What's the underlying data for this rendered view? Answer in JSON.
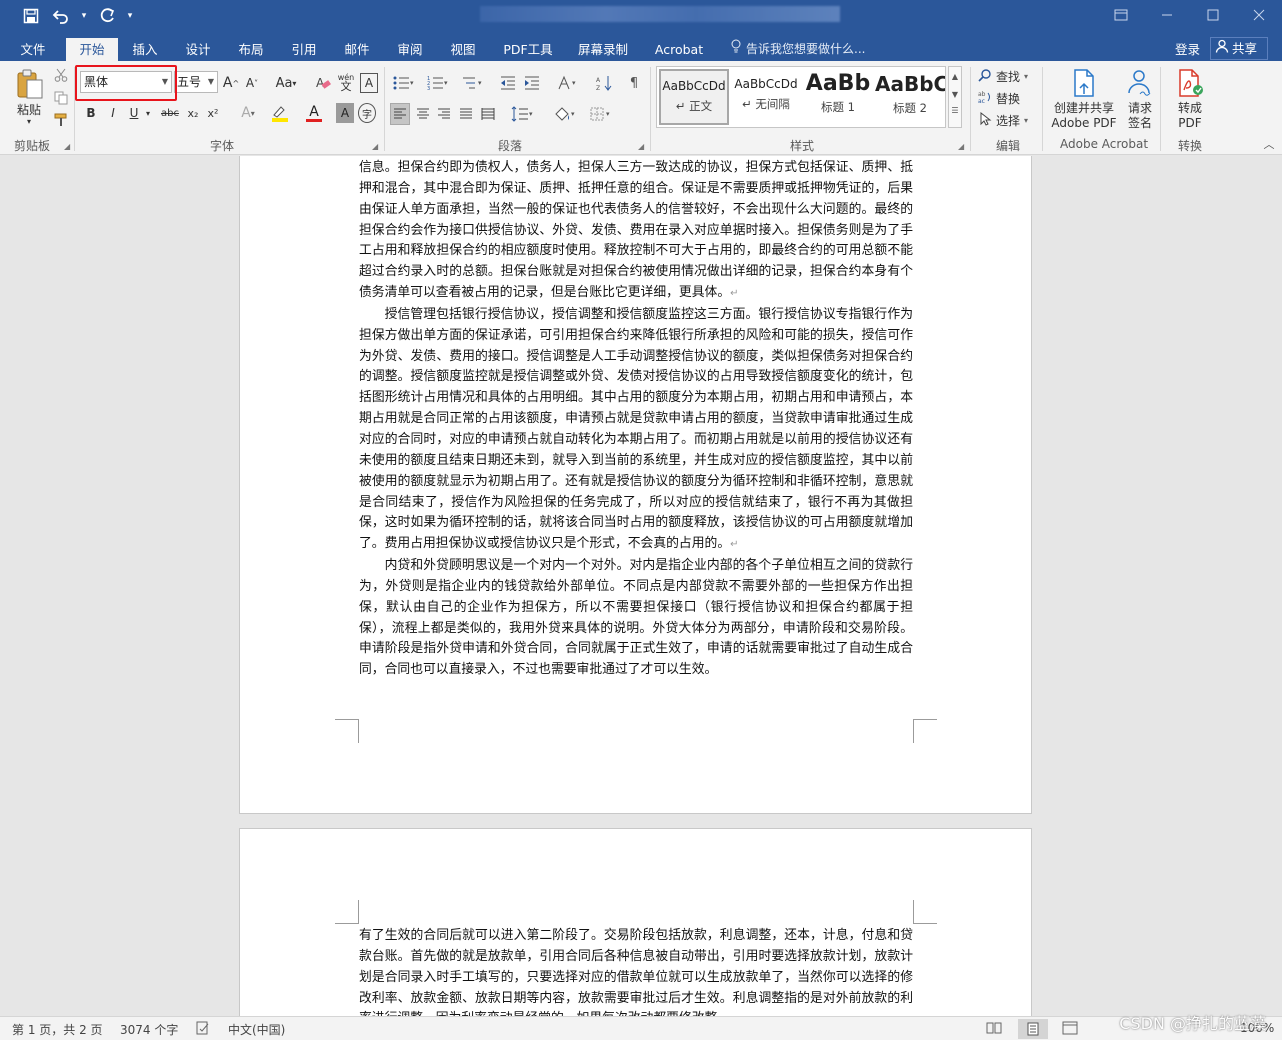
{
  "qat": {
    "save": "save-icon",
    "undo": "undo-icon",
    "redo": "redo-icon",
    "customize": "customize-icon"
  },
  "window_controls": [
    "restore-ribbon-icon",
    "minimize-icon",
    "maximize-icon",
    "close-icon"
  ],
  "tabs": [
    "文件",
    "开始",
    "插入",
    "设计",
    "布局",
    "引用",
    "邮件",
    "审阅",
    "视图",
    "PDF工具",
    "屏幕录制",
    "Acrobat"
  ],
  "active_tab": "开始",
  "tell_me": "告诉我您想要做什么...",
  "login": "登录",
  "share": "共享",
  "ribbon": {
    "clipboard": {
      "paste": "粘贴",
      "label": "剪贴板"
    },
    "font": {
      "font_name": "黑体",
      "font_size": "五号",
      "label": "字体",
      "buttons": {
        "bold": "B",
        "italic": "I",
        "underline": "U",
        "strike": "abc",
        "sub": "x₂",
        "sup": "x²",
        "grow": "A",
        "shrink": "A",
        "case": "Aa",
        "phonetic": "wén",
        "border": "A",
        "color": "A",
        "shade": "A",
        "circle": "字"
      }
    },
    "paragraph": {
      "label": "段落"
    },
    "styles": {
      "label": "样式",
      "items": [
        {
          "sample": "AaBbCcDd",
          "name": "↵ 正文"
        },
        {
          "sample": "AaBbCcDd",
          "name": "↵ 无间隔"
        },
        {
          "sample": "AaBb",
          "name": "标题 1"
        },
        {
          "sample": "AaBbC",
          "name": "标题 2"
        }
      ]
    },
    "editing": {
      "label": "编辑",
      "find": "查找",
      "replace": "替换",
      "select": "选择"
    },
    "adobe": {
      "label": "Adobe Acrobat",
      "create_share": "创建并共享",
      "create_share2": "Adobe PDF",
      "request": "请求",
      "request2": "签名"
    },
    "convert": {
      "label": "转换",
      "to_pdf": "转成",
      "to_pdf2": "PDF"
    }
  },
  "document": {
    "page1_paragraphs": [
      {
        "indent": false,
        "text": "信息。担保合约即为债权人，债务人，担保人三方一致达成的协议，担保方式包括保证、质押、抵押和混合，其中混合即为保证、质押、抵押任意的组合。保证是不需要质押或抵押物凭证的，后果由保证人单方面承担，当然一般的保证也代表债务人的信誉较好，不会出现什么大问题的。最终的担保合约会作为接口供授信协议、外贷、发债、费用在录入对应单据时接入。担保债务则是为了手工占用和释放担保合约的相应额度时使用。释放控制不可大于占用的，即最终合约的可用总额不能超过合约录入时的总额。担保台账就是对担保合约被使用情况做出详细的记录，担保合约本身有个债务清单可以查看被占用的记录，但是台账比它更详细，更具体。"
      },
      {
        "indent": true,
        "text": "授信管理包括银行授信协议，授信调整和授信额度监控这三方面。银行授信协议专指银行作为担保方做出单方面的保证承诺，可引用担保合约来降低银行所承担的风险和可能的损失，授信可作为外贷、发债、费用的接口。授信调整是人工手动调整授信协议的额度，类似担保债务对担保合约的调整。授信额度监控就是授信调整或外贷、发债对授信协议的占用导致授信额度变化的统计，包括图形统计占用情况和具体的占用明细。其中占用的额度分为本期占用，初期占用和申请预占，本期占用就是合同正常的占用该额度，申请预占就是贷款申请占用的额度，当贷款申请审批通过生成对应的合同时，对应的申请预占就自动转化为本期占用了。而初期占用就是以前用的授信协议还有未使用的额度且结束日期还未到，就导入到当前的系统里，并生成对应的授信额度监控，其中以前被使用的额度就显示为初期占用了。还有就是授信协议的额度分为循环控制和非循环控制，意思就是合同结束了，授信作为风险担保的任务完成了，所以对应的授信就结束了，银行不再为其做担保，这时如果为循环控制的话，就将该合同当时占用的额度释放，该授信协议的可占用额度就增加了。费用占用担保协议或授信协议只是个形式，不会真的占用的。"
      },
      {
        "indent": true,
        "text": "内贷和外贷顾明思议是一个对内一个对外。对内是指企业内部的各个子单位相互之间的贷款行为，外贷则是指企业内的钱贷款给外部单位。不同点是内部贷款不需要外部的一些担保方作出担保，默认由自己的企业作为担保方，所以不需要担保接口（银行授信协议和担保合约都属于担保），流程上都是类似的，我用外贷来具体的说明。外贷大体分为两部分，申请阶段和交易阶段。申请阶段是指外贷申请和外贷合同，合同就属于正式生效了，申请的话就需要审批过了自动生成合同，合同也可以直接录入，不过也需要审批通过了才可以生效。"
      }
    ],
    "page2_text": "有了生效的合同后就可以进入第二阶段了。交易阶段包括放款，利息调整，还本，计息，付息和贷款台账。首先做的就是放款单，引用合同后各种信息被自动带出，引用时要选择放款计划，放款计划是合同录入时手工填写的，只要选择对应的借款单位就可以生成放款单了，当然你可以选择的修改利率、放款金额、放款日期等内容，放款需要审批过后才生效。利息调整指的是对外前放款的利率进行调整，因为利率变动是经常的，如果每次改动都要修改整"
  },
  "status": {
    "page": "第 1 页，共 2 页",
    "words": "3074 个字",
    "language": "中文(中国)",
    "zoom": "100%"
  },
  "watermark": "CSDN @挣扎的蓝藻"
}
